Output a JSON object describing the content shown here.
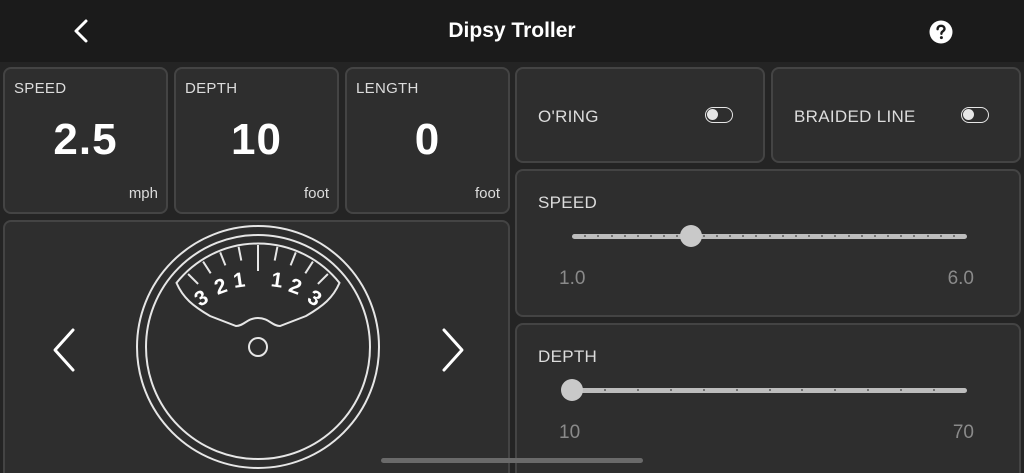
{
  "header": {
    "title": "Dipsy Troller",
    "back_icon": "chevron-left-icon",
    "help_icon": "question-circle-icon"
  },
  "stats": {
    "speed": {
      "label": "SPEED",
      "value": "2.5",
      "unit": "mph"
    },
    "depth": {
      "label": "DEPTH",
      "value": "10",
      "unit": "foot"
    },
    "length": {
      "label": "LENGTH",
      "value": "0",
      "unit": "foot"
    }
  },
  "dial": {
    "scale_left": [
      "3",
      "2",
      "1"
    ],
    "scale_right": [
      "1",
      "2",
      "3"
    ],
    "prev_icon": "chevron-left-icon",
    "next_icon": "chevron-right-icon"
  },
  "toggles": {
    "oring": {
      "label": "O'RING",
      "on": false
    },
    "braided": {
      "label": "BRAIDED LINE",
      "on": false
    }
  },
  "sliders": {
    "speed": {
      "label": "SPEED",
      "min": "1.0",
      "max": "6.0",
      "value": 2.5,
      "min_value": 1.0,
      "max_value": 6.0,
      "ticks": 31
    },
    "depth": {
      "label": "DEPTH",
      "min": "10",
      "max": "70",
      "value": 10,
      "min_value": 10,
      "max_value": 70,
      "ticks": 13
    }
  },
  "colors": {
    "background": "#242424",
    "header": "#1b1b1b",
    "card": "#2e2e2e",
    "card_border": "#444444",
    "text": "#ffffff"
  }
}
